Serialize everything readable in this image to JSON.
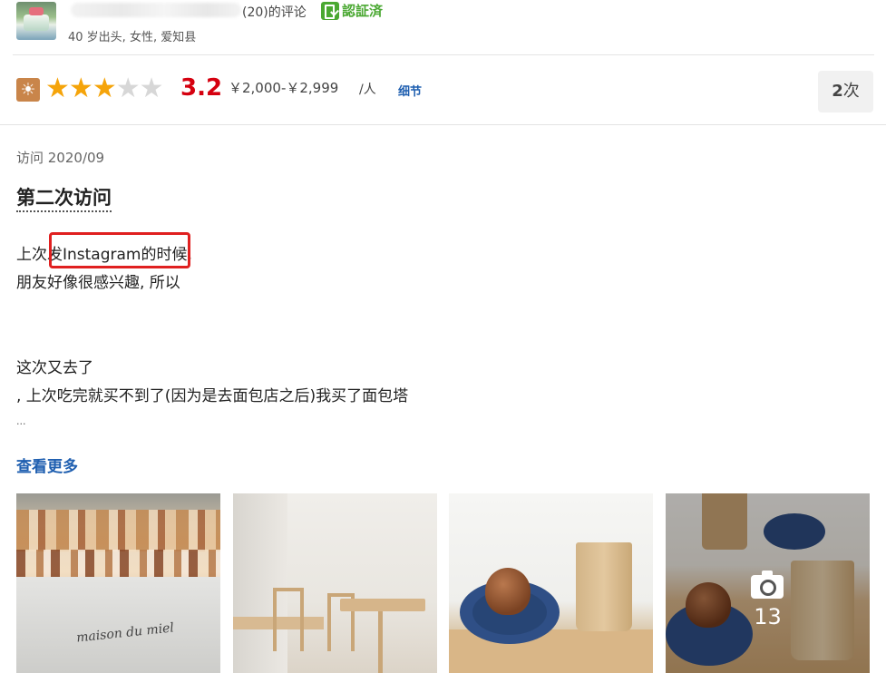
{
  "reviewer": {
    "review_count": "(20)的评论",
    "verified_label": "認証済",
    "profile": "40 岁出头, 女性, 爱知县"
  },
  "rating": {
    "stars_filled": 3,
    "stars_total": 5,
    "score": "3.2",
    "price": "￥2,000-￥2,999",
    "per_person": "/人",
    "detail_link": "细节",
    "visit_count_number": "2",
    "visit_count_unit": "次"
  },
  "review": {
    "visit_date": "访问 2020/09",
    "title": "第二次访问",
    "lines": [
      "上次发Instagram的时候,",
      "朋友好像很感兴趣, 所以",
      "这次又去了",
      ", 上次吃完就买不到了(因为是去面包店之后)我买了面包塔"
    ],
    "ellipsis": "...",
    "read_more": "查看更多"
  },
  "photos": {
    "photo1_logo": "maison du miel",
    "more_count": "13"
  },
  "colors": {
    "score_red": "#d5000f",
    "star_orange": "#f5a40a",
    "link_blue": "#1f5fb0",
    "verified_green": "#4aa832",
    "highlight_red": "#e02020"
  }
}
